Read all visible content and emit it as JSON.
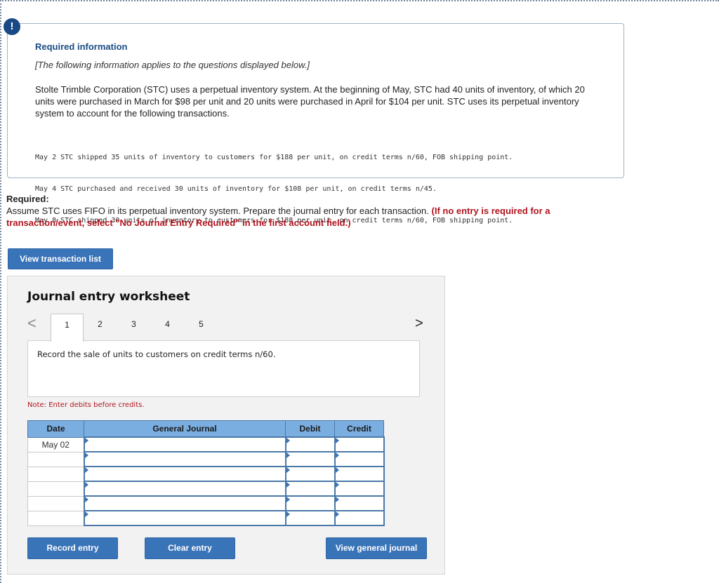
{
  "alert": {
    "icon": "exclamation-icon",
    "glyph": "!"
  },
  "info": {
    "title": "Required information",
    "subtitle": "[The following information applies to the questions displayed below.]",
    "paragraph": "Stolte Trimble Corporation (STC) uses a perpetual inventory system. At the beginning of May, STC had 40 units of inventory, of which 20 units were purchased in March for $98 per unit and 20 units were purchased in April for $104 per unit. STC uses its perpetual inventory system to account for the following transactions.",
    "transactions": [
      "May 2 STC shipped 35 units of inventory to customers for $188 per unit, on credit terms n/60, FOB shipping point.",
      "May 4 STC purchased and received 30 units of inventory for $108 per unit, on credit terms n/45.",
      "May 8 STC shipped 30 units of inventory to customers for $188 per unit, on credit terms n/60, FOB shipping point."
    ]
  },
  "required": {
    "heading": "Required:",
    "text": "Assume STC uses FIFO in its perpetual inventory system. Prepare the journal entry for each transaction.",
    "emphasis": "(If no entry is required for a transaction/event, select \"No Journal Entry Required\" in the first account field.)"
  },
  "buttons": {
    "view_transactions": "View transaction list",
    "record_entry": "Record entry",
    "clear_entry": "Clear entry",
    "view_general_journal": "View general journal"
  },
  "worksheet": {
    "title": "Journal entry worksheet",
    "prev_glyph": "<",
    "next_glyph": ">",
    "tabs": [
      "1",
      "2",
      "3",
      "4",
      "5"
    ],
    "active_tab": "1",
    "prompt": "Record the sale of units to customers on credit terms n/60.",
    "note": "Note: Enter debits before credits.",
    "table": {
      "headers": [
        "Date",
        "General Journal",
        "Debit",
        "Credit"
      ],
      "rows": [
        {
          "date": "May 02",
          "account": "",
          "debit": "",
          "credit": ""
        },
        {
          "date": "",
          "account": "",
          "debit": "",
          "credit": ""
        },
        {
          "date": "",
          "account": "",
          "debit": "",
          "credit": ""
        },
        {
          "date": "",
          "account": "",
          "debit": "",
          "credit": ""
        },
        {
          "date": "",
          "account": "",
          "debit": "",
          "credit": ""
        },
        {
          "date": "",
          "account": "",
          "debit": "",
          "credit": ""
        }
      ]
    }
  },
  "colors": {
    "accent": "#3a74b8",
    "heading_blue": "#1b4c84",
    "warning_red": "#b0141e",
    "table_header": "#7aaee0"
  }
}
